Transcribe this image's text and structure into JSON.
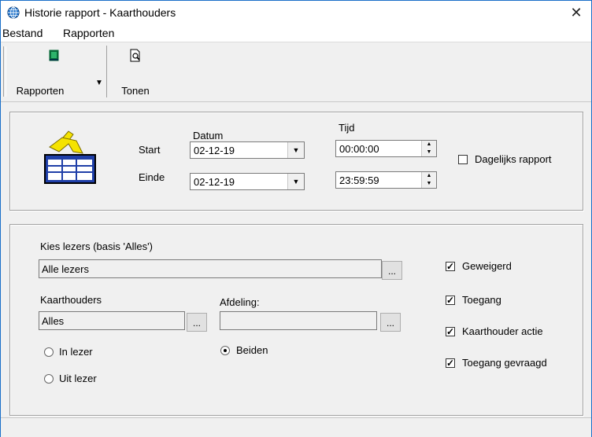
{
  "window": {
    "title": "Historie rapport - Kaarthouders",
    "close_glyph": "✕"
  },
  "menu": {
    "items": [
      "Bestand",
      "Rapporten"
    ]
  },
  "toolbar": {
    "rapporten_label": "Rapporten",
    "tonen_label": "Tonen"
  },
  "period": {
    "datum_header": "Datum",
    "tijd_header": "Tijd",
    "start_label": "Start",
    "einde_label": "Einde",
    "start_date": "02-12-19",
    "end_date": "02-12-19",
    "start_time": "00:00:00",
    "end_time": "23:59:59",
    "daily_label": "Dagelijks rapport",
    "daily_checked": false
  },
  "filters": {
    "readers_label": "Kies lezers (basis 'Alles')",
    "readers_value": "Alle lezers",
    "cardholders_label": "Kaarthouders",
    "cardholders_value": "Alles",
    "department_label": "Afdeling:",
    "department_value": "",
    "browse_label": "...",
    "radio_in": "In lezer",
    "radio_out": "Uit lezer",
    "radio_both": "Beiden",
    "selected_radio": "Beiden"
  },
  "events": [
    {
      "label": "Geweigerd",
      "checked": true
    },
    {
      "label": "Toegang",
      "checked": true
    },
    {
      "label": "Kaarthouder actie",
      "checked": true
    },
    {
      "label": "Toegang gevraagd",
      "checked": true
    }
  ],
  "icons": {
    "app": "globe-icon",
    "report": "person-table-icon",
    "book": "book-icon",
    "preview": "print-preview-icon"
  },
  "colors": {
    "accent": "#1a6fc9",
    "icon_yellow": "#f5e300",
    "icon_blue": "#1f3fa8"
  }
}
